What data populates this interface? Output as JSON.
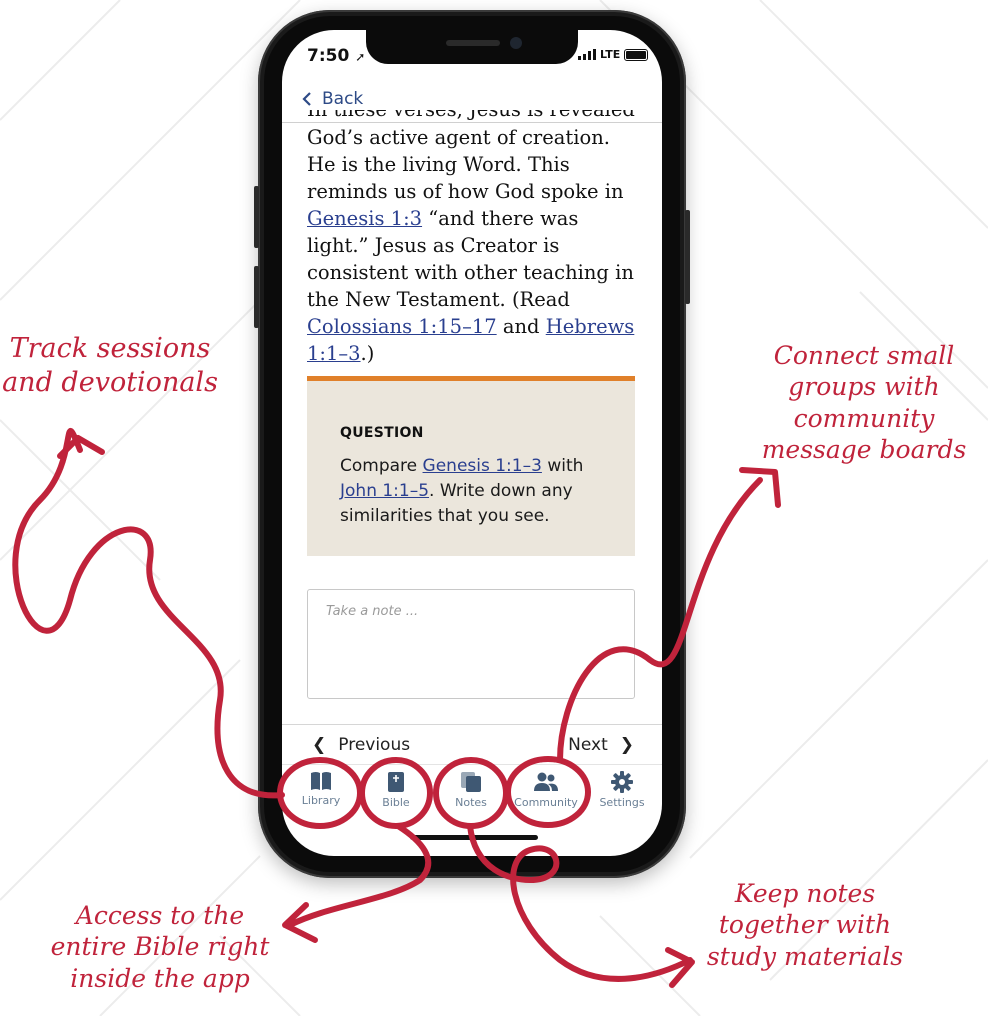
{
  "status": {
    "time": "7:50",
    "network": "LTE"
  },
  "nav": {
    "back_label": "Back"
  },
  "reading": {
    "clipped_line": "In these verses, Jesus is revealed as",
    "p1": "God’s active agent of creation. He is the living Word. This reminds us of how God spoke in ",
    "link1": "Genesis 1:3",
    "p2": " “and there was light.” Jesus as Creator is consistent with other teaching in the New Testament. (Read ",
    "link2": "Colossians 1:15–17",
    "p3": " and ",
    "link3": "Hebrews 1:1–3",
    "p4": ".)"
  },
  "question": {
    "label": "QUESTION",
    "t1": "Compare ",
    "link1": "Genesis 1:1–3",
    "t2": " with ",
    "link2": "John 1:1–5",
    "t3": ". Write down any similarities that you see."
  },
  "note": {
    "placeholder": "Take a note ..."
  },
  "pager": {
    "previous": "Previous",
    "next": "Next"
  },
  "tabs": [
    {
      "label": "Library",
      "icon": "book-icon"
    },
    {
      "label": "Bible",
      "icon": "bible-icon"
    },
    {
      "label": "Notes",
      "icon": "notes-icon"
    },
    {
      "label": "Community",
      "icon": "community-icon"
    },
    {
      "label": "Settings",
      "icon": "gear-icon"
    }
  ],
  "annotations": {
    "track": "Track sessions and devotionals",
    "connect": "Connect small groups with community message boards",
    "access": "Access to the entire Bible right inside the app",
    "keep": "Keep notes together with study materials"
  },
  "colors": {
    "accent_link": "#2a3f8f",
    "question_bar": "#e0802a",
    "question_bg": "#ebe6dc",
    "annotation_red": "#c0233b",
    "tab_icon": "#3f5873"
  }
}
